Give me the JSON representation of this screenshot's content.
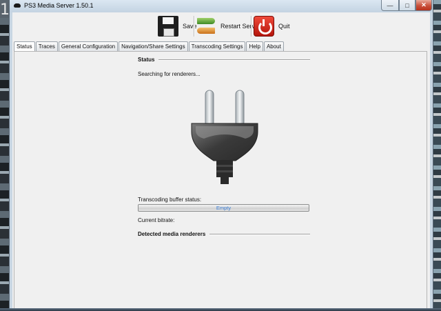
{
  "window": {
    "title": "PS3 Media Server 1.50.1",
    "minimize_glyph": "—",
    "maximize_glyph": "□",
    "close_glyph": "✕"
  },
  "desktop": {
    "partial_text": "1"
  },
  "toolbar": {
    "save_label": "Save",
    "restart_label": "Restart Server",
    "quit_label": "Quit"
  },
  "tabs": [
    {
      "label": "Status",
      "active": true
    },
    {
      "label": "Traces",
      "active": false
    },
    {
      "label": "General Configuration",
      "active": false
    },
    {
      "label": "Navigation/Share Settings",
      "active": false
    },
    {
      "label": "Transcoding Settings",
      "active": false
    },
    {
      "label": "Help",
      "active": false
    },
    {
      "label": "About",
      "active": false
    }
  ],
  "status": {
    "section_title": "Status",
    "searching_text": "Searching for renderers...",
    "plug_icon": "power-plug-icon",
    "buffer_label": "Transcoding buffer status:",
    "buffer_value_text": "Empty",
    "buffer_fill": 0,
    "bitrate_label": "Current bitrate:",
    "renderers_title": "Detected media renderers"
  },
  "colors": {
    "accent_text": "#3a7ed6",
    "quit_red": "#d2231a",
    "window_frame": "#c8d6e3"
  }
}
